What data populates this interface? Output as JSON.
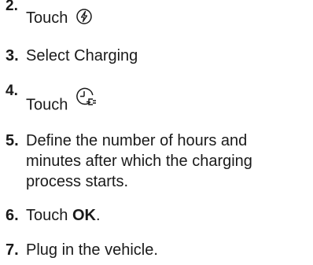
{
  "steps": [
    {
      "number": "2.",
      "text": "Touch",
      "icon": "charge-bolt-icon"
    },
    {
      "number": "3.",
      "text": "Select Charging"
    },
    {
      "number": "4.",
      "text": "Touch",
      "icon": "timer-plug-icon"
    },
    {
      "number": "5.",
      "text": "Define the number of hours and minutes after which the charging process starts."
    },
    {
      "number": "6.",
      "text_before": "Touch ",
      "bold": "OK",
      "text_after": "."
    },
    {
      "number": "7.",
      "text": "Plug in the vehicle."
    }
  ]
}
